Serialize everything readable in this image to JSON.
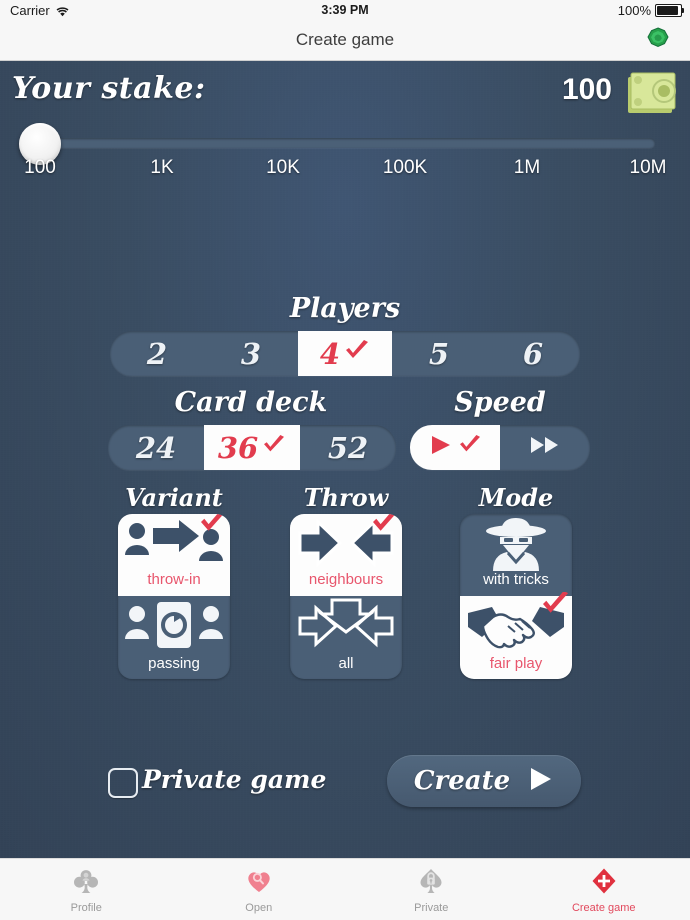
{
  "statusbar": {
    "carrier": "Carrier",
    "time": "3:39 PM",
    "battery": "100%",
    "wifi_icon": "wifi-icon",
    "battery_icon": "battery-icon"
  },
  "navbar": {
    "title": "Create game",
    "gem_icon": "gem-icon"
  },
  "stake": {
    "label": "Your stake:",
    "value": "100",
    "money_icon": "money-stack-icon",
    "slider": {
      "position_percent": 0,
      "ticks": [
        "100",
        "1K",
        "10K",
        "100K",
        "1M",
        "10M"
      ]
    }
  },
  "players": {
    "title": "Players",
    "options": [
      "2",
      "3",
      "4",
      "5",
      "6"
    ],
    "selected": "4"
  },
  "card_deck": {
    "title": "Card deck",
    "options": [
      "24",
      "36",
      "52"
    ],
    "selected": "36"
  },
  "speed": {
    "title": "Speed",
    "options": [
      {
        "icon": "play-icon",
        "label": "normal"
      },
      {
        "icon": "fast-forward-icon",
        "label": "fast"
      }
    ],
    "selected": "normal"
  },
  "variant": {
    "title": "Variant",
    "options": [
      {
        "label": "throw-in",
        "icon": "throw-in-icon",
        "selected": true
      },
      {
        "label": "passing",
        "icon": "passing-icon",
        "selected": false
      }
    ]
  },
  "throw": {
    "title": "Throw",
    "options": [
      {
        "label": "neighbours",
        "icon": "neighbours-arrows-icon",
        "selected": true
      },
      {
        "label": "all",
        "icon": "all-arrows-icon",
        "selected": false
      }
    ]
  },
  "mode": {
    "title": "Mode",
    "options": [
      {
        "label": "with tricks",
        "icon": "bandit-icon",
        "selected": false
      },
      {
        "label": "fair play",
        "icon": "handshake-icon",
        "selected": true
      }
    ]
  },
  "bottom": {
    "private_game_label": "Private game",
    "private_game_checked": false,
    "create_label": "Create",
    "create_arrow_icon": "play-arrow-icon"
  },
  "tabbar": {
    "items": [
      {
        "label": "Profile",
        "icon": "club-profile-icon",
        "active": false
      },
      {
        "label": "Open",
        "icon": "heart-search-icon",
        "active": false
      },
      {
        "label": "Private",
        "icon": "spade-lock-icon",
        "active": false
      },
      {
        "label": "Create game",
        "icon": "diamond-plus-icon",
        "active": true
      }
    ]
  },
  "colors": {
    "background": "#3a4d62",
    "panel": "#4a5f76",
    "accent_red": "#e23c4e",
    "accent_pink": "#e8566d",
    "white": "#ffffff",
    "gem_green": "#2eae53",
    "money_green": "#cfe08a"
  }
}
